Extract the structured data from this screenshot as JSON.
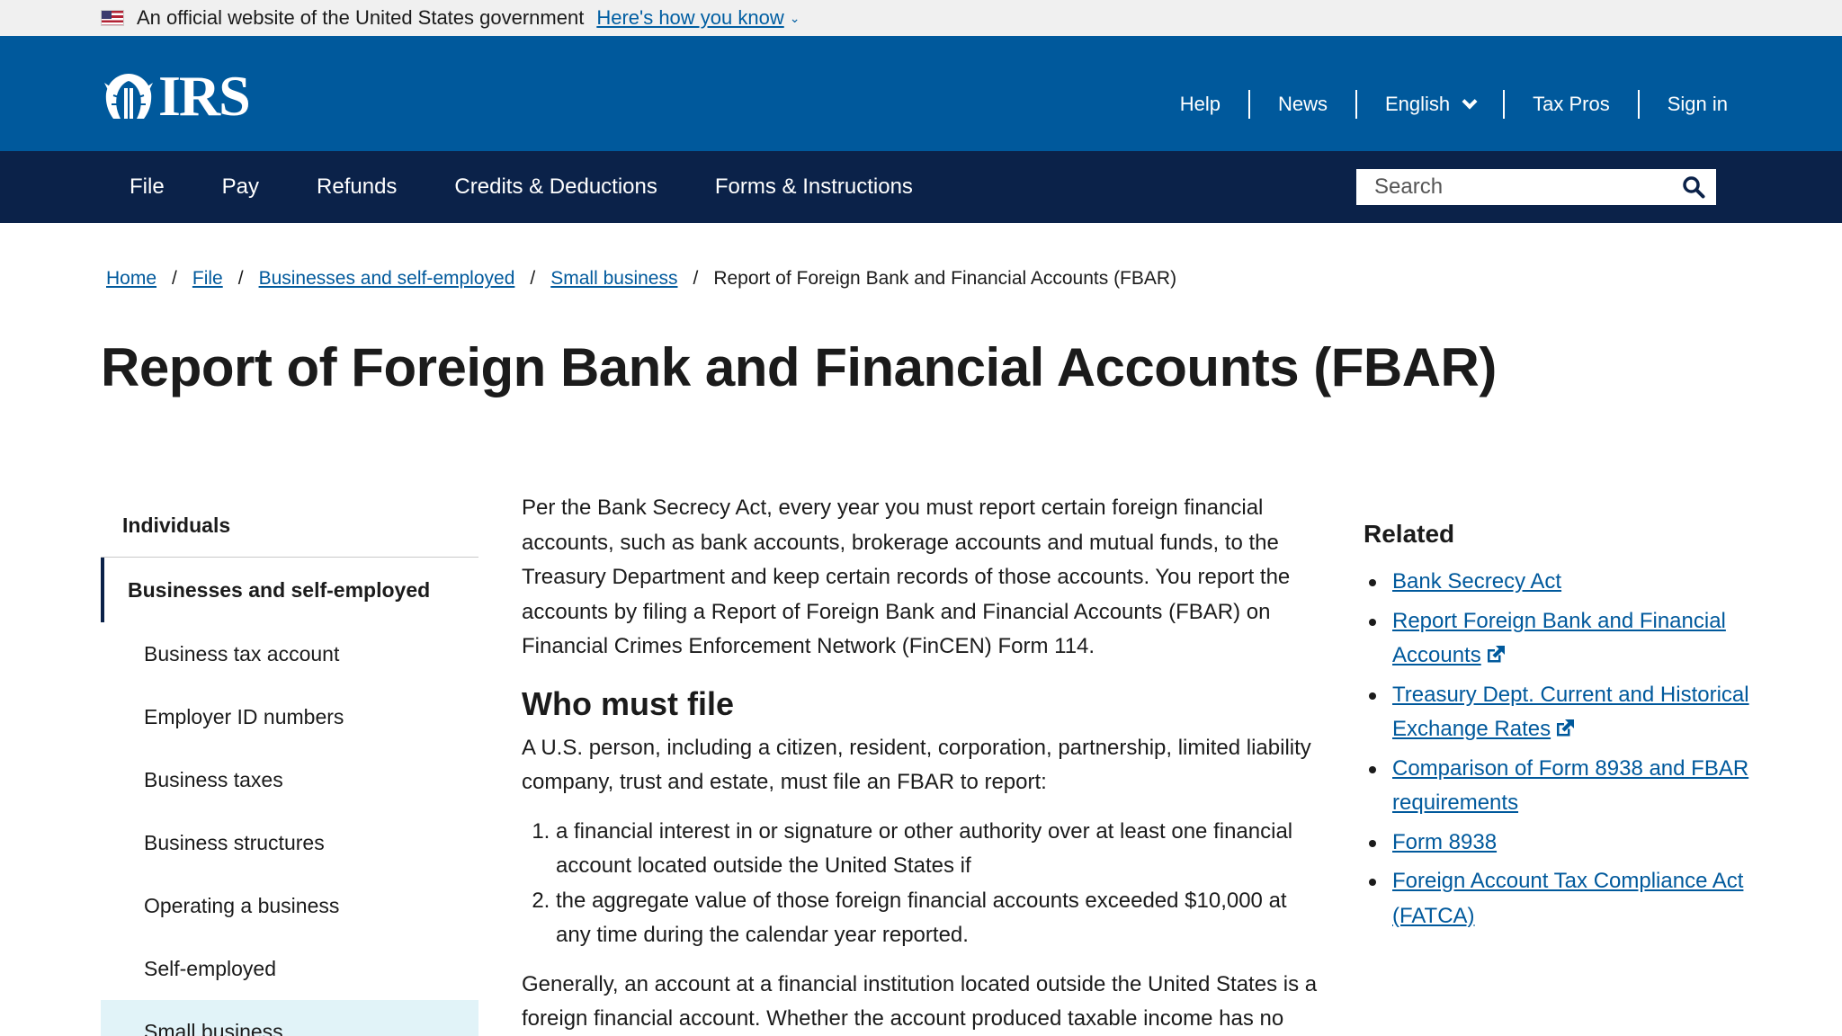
{
  "gov_banner": {
    "text": "An official website of the United States government",
    "link": "Here's how you know"
  },
  "header": {
    "logo_text": "IRS",
    "utility_nav": [
      {
        "label": "Help"
      },
      {
        "label": "News"
      },
      {
        "label": "English"
      },
      {
        "label": "Tax Pros"
      },
      {
        "label": "Sign in"
      }
    ]
  },
  "main_nav": {
    "items": [
      {
        "label": "File"
      },
      {
        "label": "Pay"
      },
      {
        "label": "Refunds"
      },
      {
        "label": "Credits & Deductions"
      },
      {
        "label": "Forms & Instructions"
      }
    ],
    "search_placeholder": "Search"
  },
  "breadcrumb": {
    "links": [
      "Home",
      "File",
      "Businesses and self-employed",
      "Small business"
    ],
    "current": "Report of Foreign Bank and Financial Accounts (FBAR)"
  },
  "page": {
    "title": "Report of Foreign Bank and Financial Accounts (FBAR)"
  },
  "sidebar": {
    "top": "Individuals",
    "active": "Businesses and self-employed",
    "items": [
      "Business tax account",
      "Employer ID numbers",
      "Business taxes",
      "Business structures",
      "Operating a business",
      "Self-employed",
      "Small business"
    ]
  },
  "content": {
    "intro": "Per the Bank Secrecy Act, every year you must report certain foreign financial accounts, such as bank accounts, brokerage accounts and mutual funds, to the Treasury Department and keep certain records of those accounts. You report the accounts by filing a Report of Foreign Bank and Financial Accounts (FBAR) on Financial Crimes Enforcement Network (FinCEN) Form 114.",
    "heading": "Who must file",
    "who_text": "A U.S. person, including a citizen, resident, corporation, partnership, limited liability company, trust and estate, must file an FBAR to report:",
    "list": [
      "a financial interest in or signature or other authority over at least one financial account located outside the United States if",
      "the aggregate value of those foreign financial accounts exceeded $10,000 at any time during the calendar year reported."
    ],
    "generally": "Generally, an account at a financial institution located outside the United States is a foreign financial account. Whether the account produced taxable income has no"
  },
  "related": {
    "heading": "Related",
    "links": [
      {
        "label": "Bank Secrecy Act",
        "external": false
      },
      {
        "label": "Report Foreign Bank and Financial Accounts",
        "external": true
      },
      {
        "label": "Treasury Dept. Current and Historical Exchange Rates",
        "external": true
      },
      {
        "label": "Comparison of Form 8938 and FBAR requirements",
        "external": false
      },
      {
        "label": "Form 8938",
        "external": false
      },
      {
        "label": "Foreign Account Tax Compliance Act (FATCA)",
        "external": false
      }
    ]
  },
  "colors": {
    "header_blue": "#00599c",
    "nav_navy": "#0b2249",
    "link_blue": "#00599c",
    "sidebar_highlight": "#e1f3f8"
  }
}
